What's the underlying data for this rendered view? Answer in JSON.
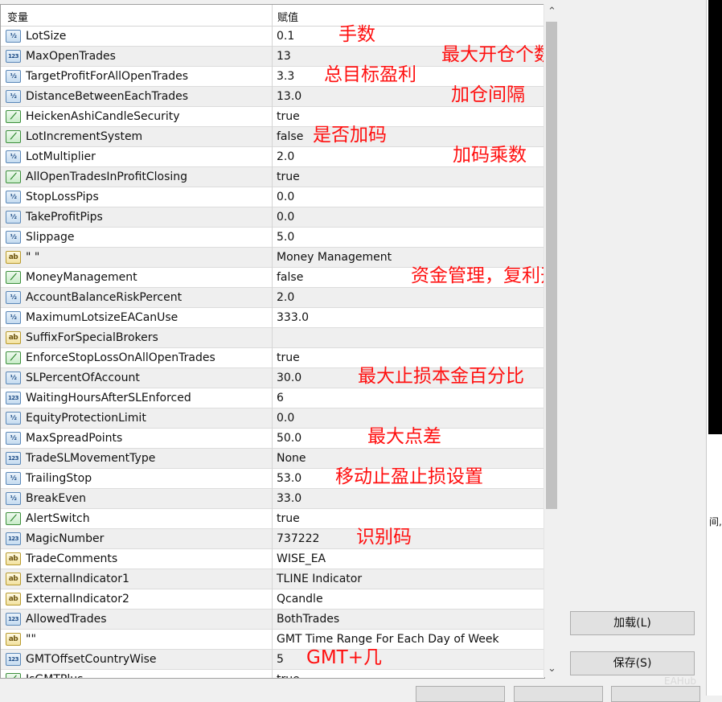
{
  "header": {
    "col_variable": "变量",
    "col_value": "赋值"
  },
  "rows": [
    {
      "type": "double",
      "name": "LotSize",
      "value": "0.1",
      "annotation": "手数"
    },
    {
      "type": "int",
      "name": "MaxOpenTrades",
      "value": "13",
      "annotation": "最大开仓个数"
    },
    {
      "type": "double",
      "name": "TargetProfitForAllOpenTrades",
      "value": "3.3",
      "annotation": "总目标盈利"
    },
    {
      "type": "double",
      "name": "DistanceBetweenEachTrades",
      "value": "13.0",
      "annotation": "加仓间隔"
    },
    {
      "type": "bool",
      "name": "HeickenAshiCandleSecurity",
      "value": "true",
      "annotation": ""
    },
    {
      "type": "bool",
      "name": "LotIncrementSystem",
      "value": "false",
      "annotation": "是否加码"
    },
    {
      "type": "double",
      "name": "LotMultiplier",
      "value": "2.0",
      "annotation": "加码乘数"
    },
    {
      "type": "bool",
      "name": "AllOpenTradesInProfitClosing",
      "value": "true",
      "annotation": ""
    },
    {
      "type": "double",
      "name": "StopLossPips",
      "value": "0.0",
      "annotation": ""
    },
    {
      "type": "double",
      "name": "TakeProfitPips",
      "value": "0.0",
      "annotation": ""
    },
    {
      "type": "double",
      "name": "Slippage",
      "value": "5.0",
      "annotation": ""
    },
    {
      "type": "string",
      "name": "\" \"",
      "value": "Money Management",
      "annotation": ""
    },
    {
      "type": "bool",
      "name": "MoneyManagement",
      "value": "false",
      "annotation": "资金管理，复利开关"
    },
    {
      "type": "double",
      "name": "AccountBalanceRiskPercent",
      "value": "2.0",
      "annotation": ""
    },
    {
      "type": "double",
      "name": "MaximumLotsizeEACanUse",
      "value": "333.0",
      "annotation": ""
    },
    {
      "type": "string",
      "name": "SuffixForSpecialBrokers",
      "value": "",
      "annotation": ""
    },
    {
      "type": "bool",
      "name": "EnforceStopLossOnAllOpenTrades",
      "value": "true",
      "annotation": ""
    },
    {
      "type": "double",
      "name": "SLPercentOfAccount",
      "value": "30.0",
      "annotation": "最大止损本金百分比"
    },
    {
      "type": "int",
      "name": "WaitingHoursAfterSLEnforced",
      "value": "6",
      "annotation": ""
    },
    {
      "type": "double",
      "name": "EquityProtectionLimit",
      "value": "0.0",
      "annotation": ""
    },
    {
      "type": "double",
      "name": "MaxSpreadPoints",
      "value": "50.0",
      "annotation": "最大点差"
    },
    {
      "type": "int",
      "name": "TradeSLMovementType",
      "value": "None",
      "annotation": ""
    },
    {
      "type": "double",
      "name": "TrailingStop",
      "value": "53.0",
      "annotation": "移动止盈止损设置"
    },
    {
      "type": "double",
      "name": "BreakEven",
      "value": "33.0",
      "annotation": ""
    },
    {
      "type": "bool",
      "name": "AlertSwitch",
      "value": "true",
      "annotation": ""
    },
    {
      "type": "int",
      "name": "MagicNumber",
      "value": "737222",
      "annotation": "识别码"
    },
    {
      "type": "string",
      "name": "TradeComments",
      "value": "WISE_EA",
      "annotation": ""
    },
    {
      "type": "string",
      "name": "ExternalIndicator1",
      "value": "TLINE Indicator",
      "annotation": ""
    },
    {
      "type": "string",
      "name": "ExternalIndicator2",
      "value": "Qcandle",
      "annotation": ""
    },
    {
      "type": "int",
      "name": "AllowedTrades",
      "value": "BothTrades",
      "annotation": ""
    },
    {
      "type": "string",
      "name": "\"\"",
      "value": "GMT Time Range For Each Day of Week",
      "annotation": ""
    },
    {
      "type": "int",
      "name": "GMTOffsetCountryWise",
      "value": "5",
      "annotation": "GMT+几"
    },
    {
      "type": "bool",
      "name": "IsGMTPlus",
      "value": "true",
      "annotation": ""
    }
  ],
  "icons": {
    "double": {
      "name": "double-type-icon",
      "glyph": "½"
    },
    "int": {
      "name": "integer-type-icon",
      "glyph": "123"
    },
    "bool": {
      "name": "boolean-type-icon",
      "glyph": "⟋"
    },
    "string": {
      "name": "string-type-icon",
      "glyph": "ab"
    }
  },
  "buttons": {
    "load": "加载(L)",
    "save": "保存(S)"
  },
  "side": {
    "label": "间,"
  },
  "watermark": "EAHub",
  "colors": {
    "annotation": "#ff1010",
    "alt_row": "#efefef",
    "accent": "#5a87b8"
  }
}
